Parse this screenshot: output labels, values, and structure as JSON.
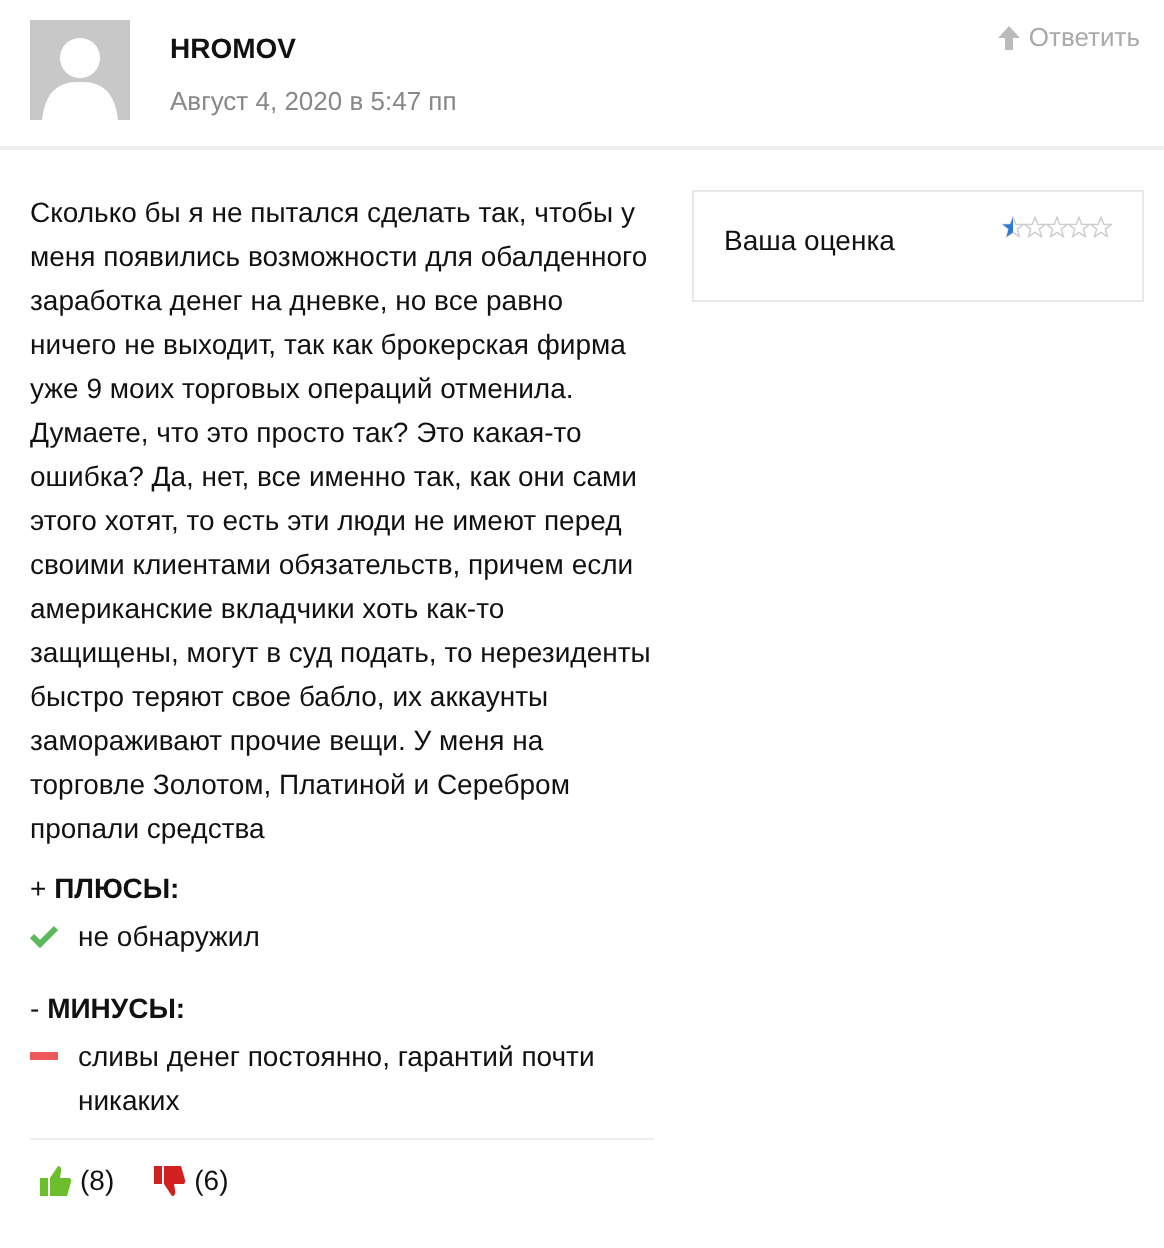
{
  "comment": {
    "author": "HROMOV",
    "date": "Август 4, 2020 в 5:47 пп",
    "reply": "Ответить",
    "text": "Сколько бы я не пытался сделать так, чтобы у меня появились возможности для обалденного заработка денег на дневке, но все равно ничего не выходит, так как брокерская фирма уже 9 моих торговых операций отменила. Думаете, что это просто так? Это какая-то ошибка? Да, нет, все именно так, как они сами этого хотят, то есть эти люди не имеют перед своими клиентами обязательств, причем если американские вкладчики хоть как-то защищены, могут в суд подать, то нерезиденты быстро теряют свое бабло, их аккаунты замораживают прочие вещи. У меня на торговле Золотом, Платиной и Серебром пропали средства",
    "sections": [
      {
        "kind": "pros",
        "heading": "+ **ПЛЮСЫ:**",
        "items": [
          "не обнаружил"
        ]
      },
      {
        "kind": "cons",
        "heading": "- **МИНУСЫ:**",
        "items": [
          "сливы денег постоянно, гарантий почти никаких"
        ]
      }
    ],
    "votes": [
      {
        "kind": "up",
        "count": "(8)"
      },
      {
        "kind": "down",
        "count": "(6)"
      }
    ]
  },
  "rating": {
    "label": "Ваша оценка",
    "stars": 0.5
  }
}
